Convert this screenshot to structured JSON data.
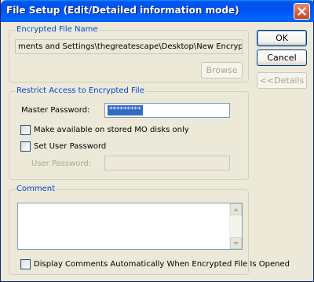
{
  "window": {
    "title": "File Setup (Edit/Detailed information mode)"
  },
  "encrypted_file": {
    "legend": "Encrypted File Name",
    "path": "ments and Settings\\thegreatescape\\Desktop\\New Encrypted File.sfa",
    "browse_label": "Browse"
  },
  "actions": {
    "ok_label": "OK",
    "cancel_label": "Cancel",
    "details_label": "<<Details"
  },
  "restrict": {
    "legend": "Restrict Access to Encrypted File",
    "master_password_label": "Master Password:",
    "master_password_value": "*********",
    "mo_disk_label": "Make available on stored MO disks only",
    "mo_disk_checked": false,
    "set_user_password_label": "Set User Password",
    "set_user_password_checked": false,
    "user_password_label": "User Password:",
    "user_password_value": ""
  },
  "comment": {
    "legend": "Comment",
    "text": "",
    "display_auto_label": "Display Comments Automatically When Encrypted File Is Opened",
    "display_auto_checked": false
  },
  "colors": {
    "title_bar": "#0053ee",
    "group_legend": "#0046d5",
    "dialog_bg": "#ece9d8",
    "selection": "#316ac5"
  }
}
